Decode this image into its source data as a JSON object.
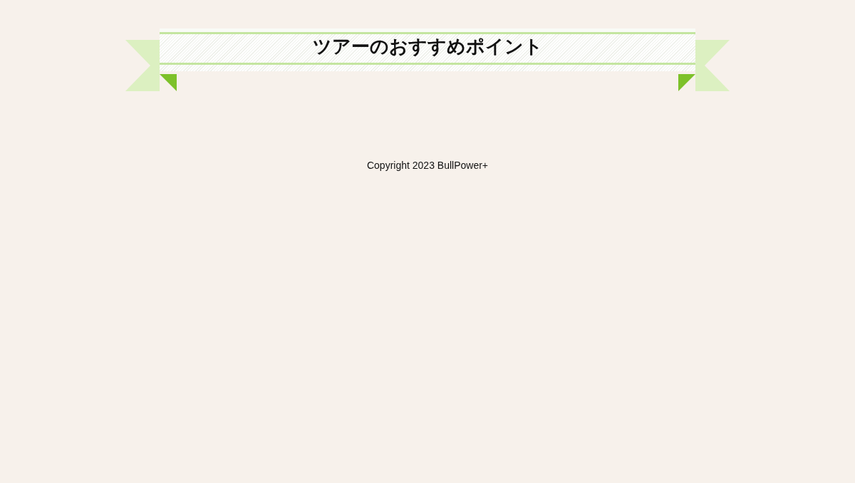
{
  "heading": {
    "title": "ツアーのおすすめポイント"
  },
  "footer": {
    "copyright": "Copyright 2023 BullPower+"
  }
}
